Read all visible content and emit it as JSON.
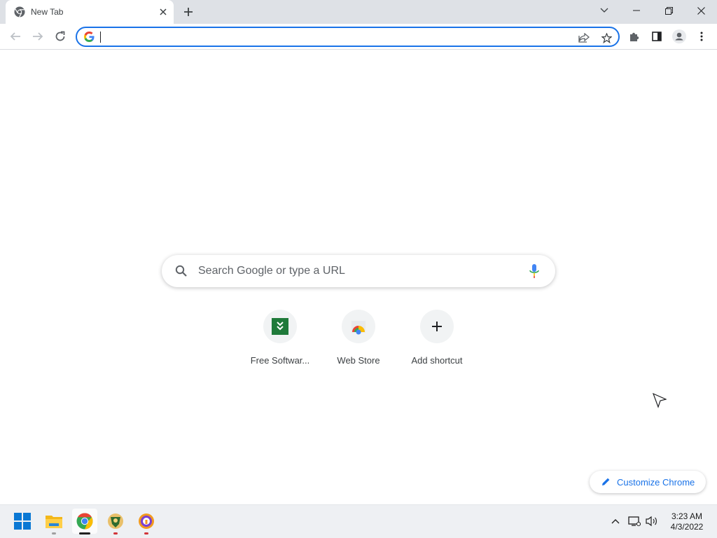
{
  "browser": {
    "tab_title": "New Tab",
    "address_value": "",
    "colors": {
      "accent": "#1a73e8",
      "tabstrip": "#dee1e6"
    }
  },
  "ntp": {
    "search_placeholder": "Search Google or type a URL",
    "shortcuts": [
      {
        "label": "Free Softwar...",
        "icon": "free-software-icon"
      },
      {
        "label": "Web Store",
        "icon": "web-store-icon"
      },
      {
        "label": "Add shortcut",
        "icon": "plus-icon"
      }
    ],
    "customize_label": "Customize Chrome"
  },
  "taskbar": {
    "apps": [
      "start",
      "file-explorer",
      "chrome",
      "app-green-badge",
      "app-orange-badge"
    ],
    "time": "3:23 AM",
    "date": "4/3/2022"
  }
}
